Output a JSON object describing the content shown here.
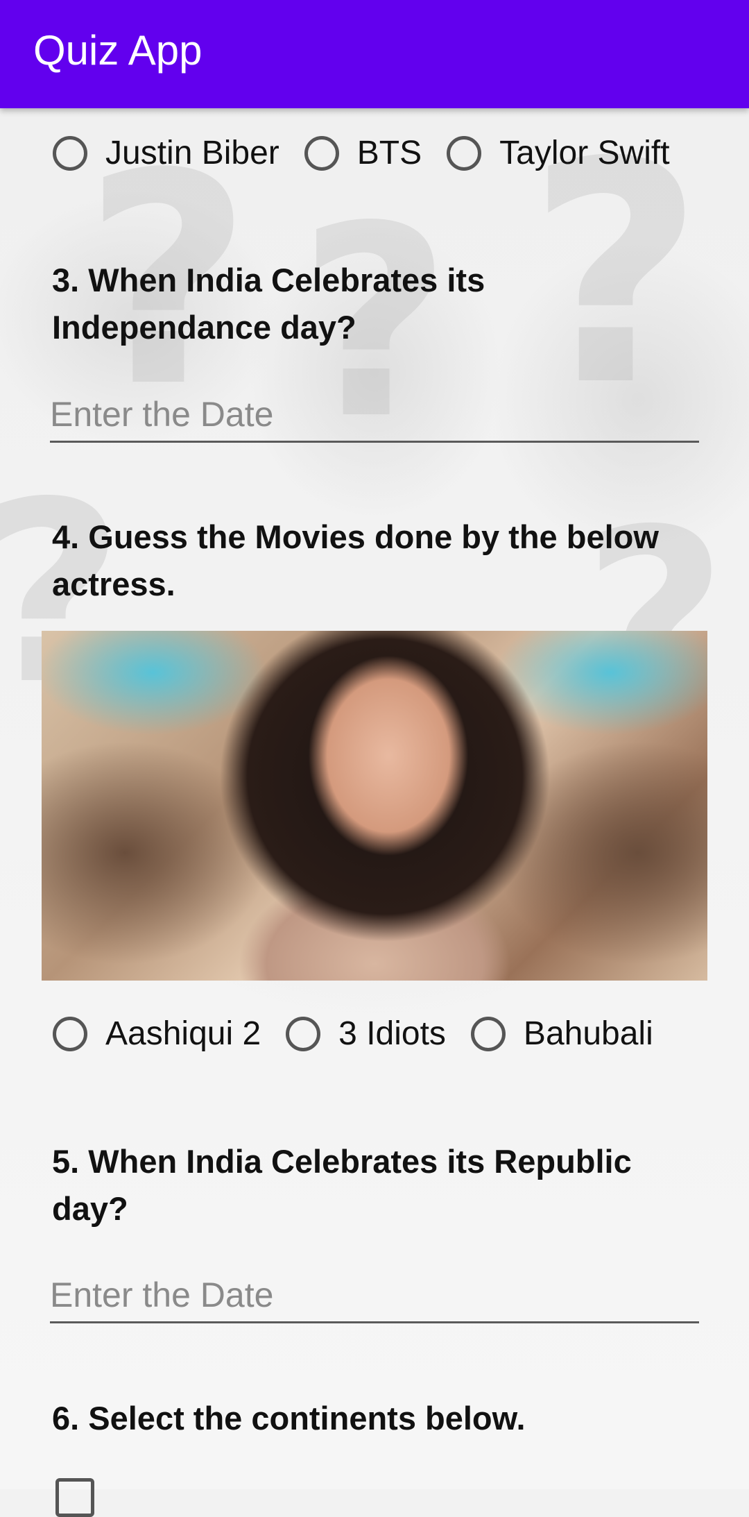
{
  "app_bar": {
    "title": "Quiz App",
    "color": "#6200ee"
  },
  "question2": {
    "options": [
      "Justin Biber",
      "BTS",
      "Taylor Swift"
    ]
  },
  "question3": {
    "text": "3. When India Celebrates its Independance day?",
    "placeholder": "Enter the Date"
  },
  "question4": {
    "text": "4. Guess the Movies done by the below actress.",
    "options": [
      "Aashiqui 2",
      "3 Idiots",
      "Bahubali"
    ]
  },
  "question5": {
    "text": "5. When India Celebrates its Republic day?",
    "placeholder": "Enter the Date"
  },
  "question6": {
    "text": "6. Select the continents below."
  }
}
